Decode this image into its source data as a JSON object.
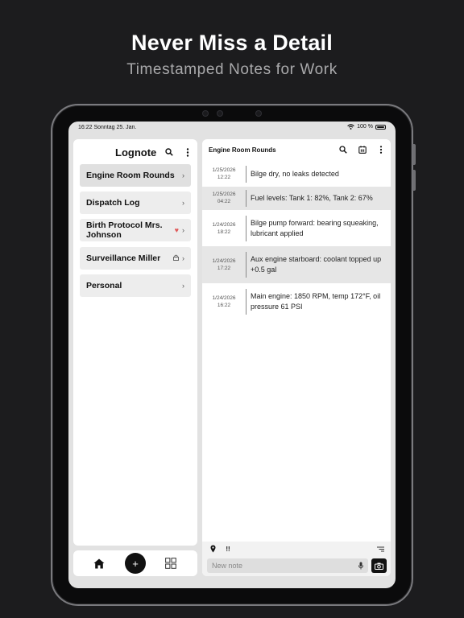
{
  "hero": {
    "title": "Never Miss a Detail",
    "subtitle": "Timestamped Notes for Work"
  },
  "status": {
    "time_date": "16:22  Sonntag 25. Jan.",
    "battery": "100 %"
  },
  "sidebar": {
    "title": "Lognote",
    "notebooks": [
      {
        "label": "Engine Room Rounds",
        "selected": true,
        "badge": null
      },
      {
        "label": "Dispatch Log",
        "selected": false,
        "badge": null
      },
      {
        "label": "Birth Protocol Mrs. Johnson",
        "selected": false,
        "badge": "heart-icon"
      },
      {
        "label": "Surveillance Miller",
        "selected": false,
        "badge": "lock-icon"
      },
      {
        "label": "Personal",
        "selected": false,
        "badge": null
      }
    ]
  },
  "main": {
    "title": "Engine Room Rounds",
    "entries": [
      {
        "date": "1/25/2026",
        "time": "12:22",
        "text": "Bilge dry, no leaks detected",
        "shaded": false
      },
      {
        "date": "1/25/2026",
        "time": "04:22",
        "text": "Fuel levels: Tank 1: 82%, Tank 2: 67%",
        "shaded": true
      },
      {
        "date": "1/24/2026",
        "time": "18:22",
        "text": "Bilge pump forward: bearing squeaking, lubricant applied",
        "shaded": false
      },
      {
        "date": "1/24/2026",
        "time": "17:22",
        "text": "Aux engine starboard: coolant topped up +0.5 gal",
        "shaded": true
      },
      {
        "date": "1/24/2026",
        "time": "16:22",
        "text": "Main engine: 1850 RPM, temp 172°F, oil pressure 61 PSI",
        "shaded": false
      }
    ],
    "priority_label": "!!",
    "input_placeholder": "New note"
  },
  "fab_label": "+",
  "colors": {
    "background": "#1c1c1e",
    "accent": "#111111",
    "selected_item": "#e0e0e0",
    "heart": "#e05a5a"
  }
}
